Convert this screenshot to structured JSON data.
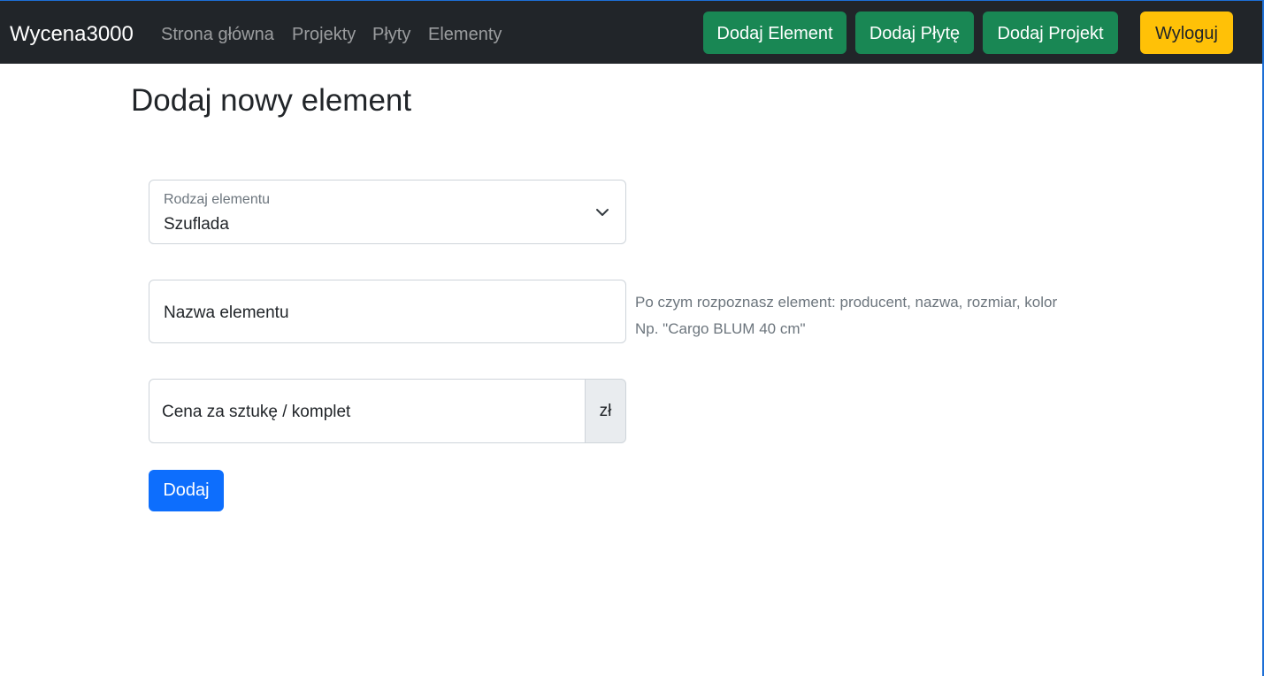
{
  "navbar": {
    "brand": "Wycena3000",
    "links": [
      {
        "label": "Strona główna"
      },
      {
        "label": "Projekty"
      },
      {
        "label": "Płyty"
      },
      {
        "label": "Elementy"
      }
    ],
    "buttons": [
      {
        "label": "Dodaj Element",
        "style": "success"
      },
      {
        "label": "Dodaj Płytę",
        "style": "success"
      },
      {
        "label": "Dodaj Projekt",
        "style": "success"
      },
      {
        "label": "Wyloguj",
        "style": "warning"
      }
    ]
  },
  "page": {
    "title": "Dodaj nowy element"
  },
  "form": {
    "element_type": {
      "label": "Rodzaj elementu",
      "selected": "Szuflada",
      "icon": "chevron-down-icon"
    },
    "name": {
      "placeholder": "Nazwa elementu",
      "help_line1": "Po czym rozpoznasz element: producent, nazwa, rozmiar, kolor",
      "help_line2": "Np. \"Cargo BLUM 40 cm\""
    },
    "price": {
      "placeholder": "Cena za sztukę / komplet",
      "currency": "zł"
    },
    "submit_label": "Dodaj"
  },
  "colors": {
    "navbar_bg": "#212529",
    "success": "#198754",
    "warning": "#ffc107",
    "primary": "#0d6efd"
  }
}
